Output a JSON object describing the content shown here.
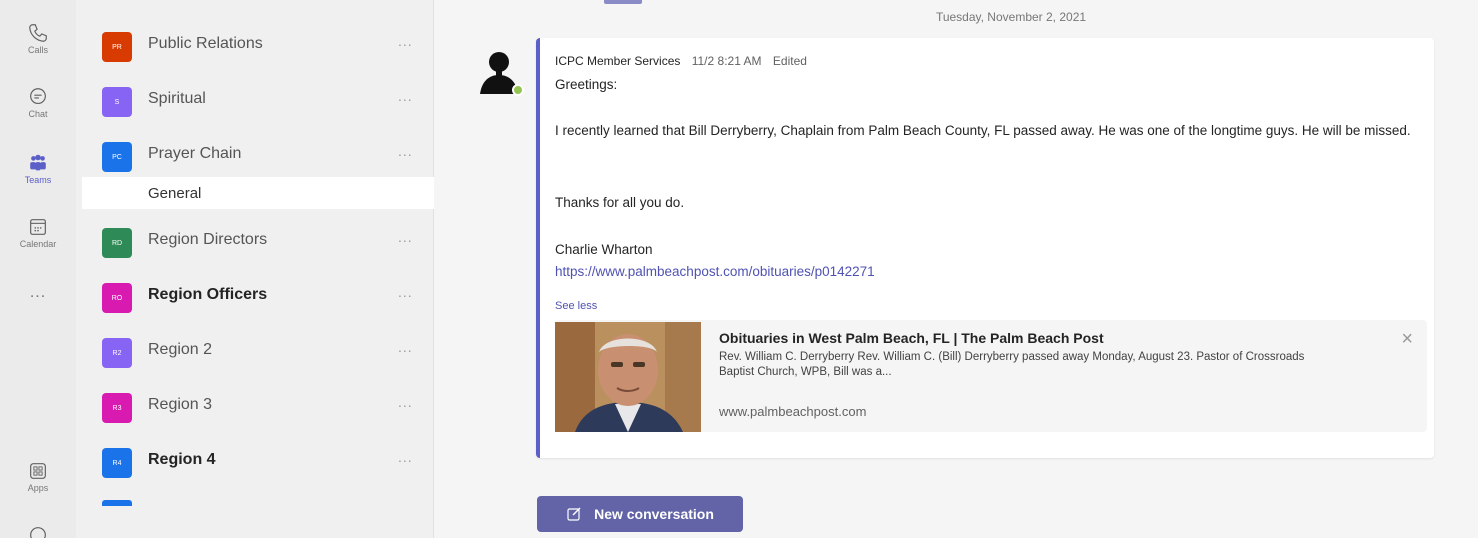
{
  "rail": {
    "items": [
      {
        "label": "Calls",
        "icon": "phone-icon"
      },
      {
        "label": "Chat",
        "icon": "chat-icon"
      },
      {
        "label": "Teams",
        "icon": "teams-icon"
      },
      {
        "label": "Calendar",
        "icon": "calendar-icon"
      },
      {
        "label": "...",
        "icon": "more-icon"
      },
      {
        "label": "Apps",
        "icon": "apps-icon"
      },
      {
        "label": "",
        "icon": "help-icon"
      }
    ]
  },
  "teams": {
    "list": [
      {
        "initials": "PR",
        "name": "Public Relations",
        "color": "#d83b01",
        "bold": false
      },
      {
        "initials": "S",
        "name": "Spiritual",
        "color": "#8764f4",
        "bold": false
      },
      {
        "initials": "PC",
        "name": "Prayer Chain",
        "color": "#1a73e8",
        "bold": false
      },
      {
        "initials": "RD",
        "name": "Region Directors",
        "color": "#2e8b57",
        "bold": false
      },
      {
        "initials": "RO",
        "name": "Region Officers",
        "color": "#d81ab0",
        "bold": true
      },
      {
        "initials": "R2",
        "name": "Region 2",
        "color": "#8764f4",
        "bold": false
      },
      {
        "initials": "R3",
        "name": "Region 3",
        "color": "#d81ab0",
        "bold": false
      },
      {
        "initials": "R4",
        "name": "Region 4",
        "color": "#1a73e8",
        "bold": true
      }
    ],
    "more_label": "...",
    "active_channel": "General"
  },
  "chat": {
    "date_separator": "Tuesday, November 2, 2021",
    "message": {
      "author": "ICPC Member Services",
      "time": "11/2 8:21 AM",
      "edited": "Edited",
      "greeting": "Greetings:",
      "body": "I recently learned that Bill Derryberry, Chaplain from Palm Beach County, FL passed away.  He was one of the longtime guys.  He will be missed.",
      "thanks": "Thanks for all you do.",
      "signature": "Charlie Wharton",
      "link": "https://www.palmbeachpost.com/obituaries/p0142271",
      "see_less": "See less"
    },
    "card": {
      "title": "Obituaries in West Palm Beach, FL | The Palm Beach Post",
      "description": "Rev. William C. Derryberry Rev. William C. (Bill) Derryberry passed away Monday, August 23. Pastor of Crossroads Baptist Church, WPB, Bill was a...",
      "domain": "www.palmbeachpost.com",
      "close": "×"
    },
    "new_conversation": "New conversation"
  }
}
